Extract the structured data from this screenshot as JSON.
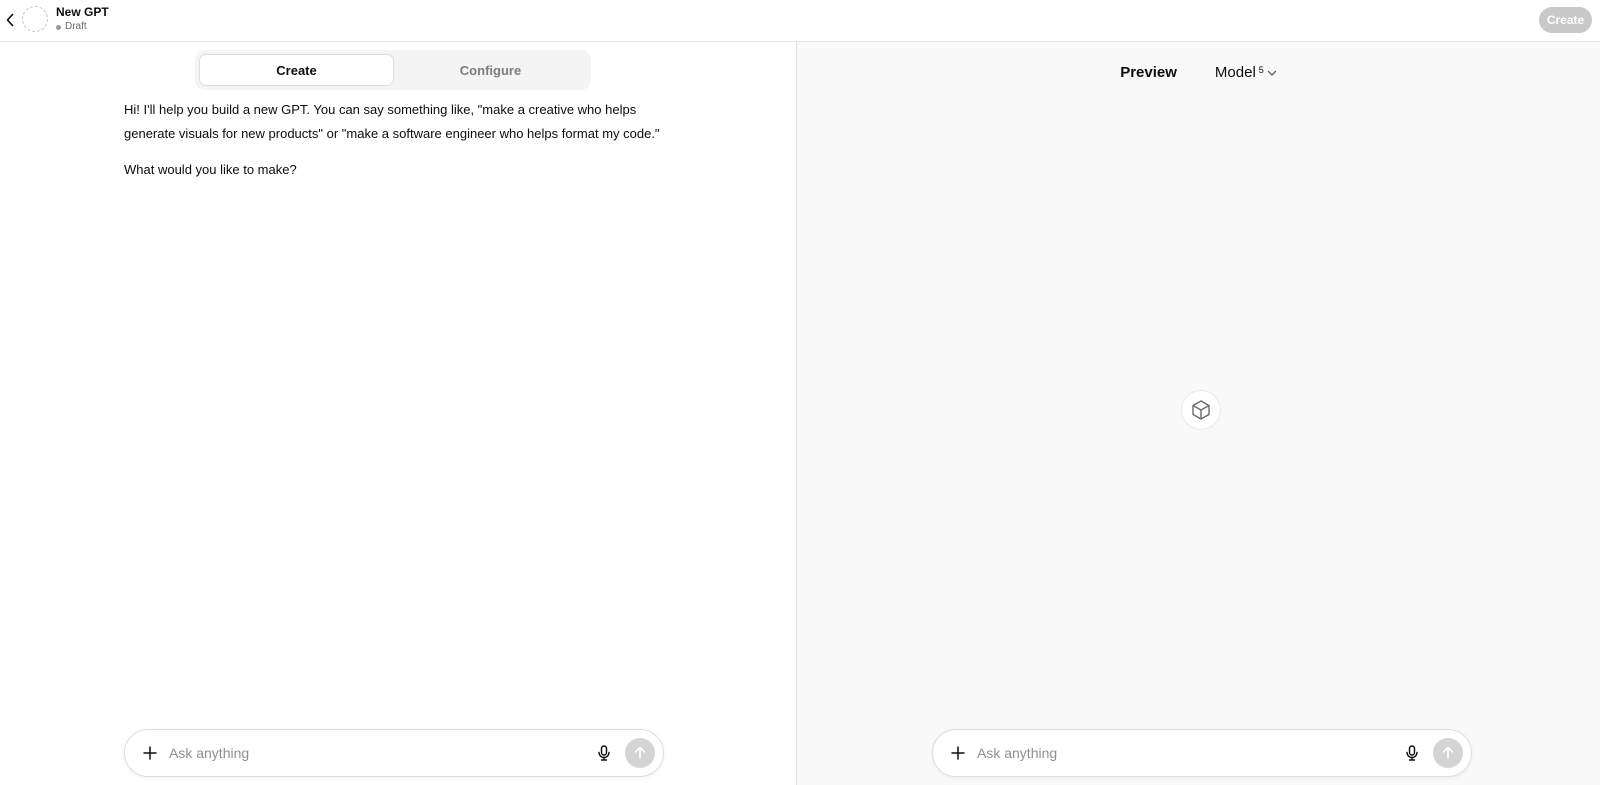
{
  "header": {
    "title": "New GPT",
    "status": "Draft",
    "create_label": "Create"
  },
  "tabs": [
    {
      "label": "Create",
      "active": true
    },
    {
      "label": "Configure",
      "active": false
    }
  ],
  "messages": [
    "Hi! I'll help you build a new GPT. You can say something like, \"make a creative who helps generate visuals for new products\" or \"make a software engineer who helps format my code.\"",
    "What would you like to make?"
  ],
  "composer_left": {
    "placeholder": "Ask anything"
  },
  "preview": {
    "label": "Preview",
    "model_label": "Model",
    "model_superscript": "5"
  },
  "composer_right": {
    "placeholder": "Ask anything"
  },
  "icons": {
    "back": "chevron-left-icon",
    "plus": "plus-icon",
    "mic": "microphone-icon",
    "send": "arrow-up-icon",
    "cube": "cube-icon",
    "dropdown": "chevron-down-icon"
  },
  "colors": {
    "create_button_bg": "#c8c8c8",
    "preview_bg": "#f9f9f9",
    "tab_track_bg": "#f4f4f4",
    "send_button_bg": "#d4d4d4"
  }
}
